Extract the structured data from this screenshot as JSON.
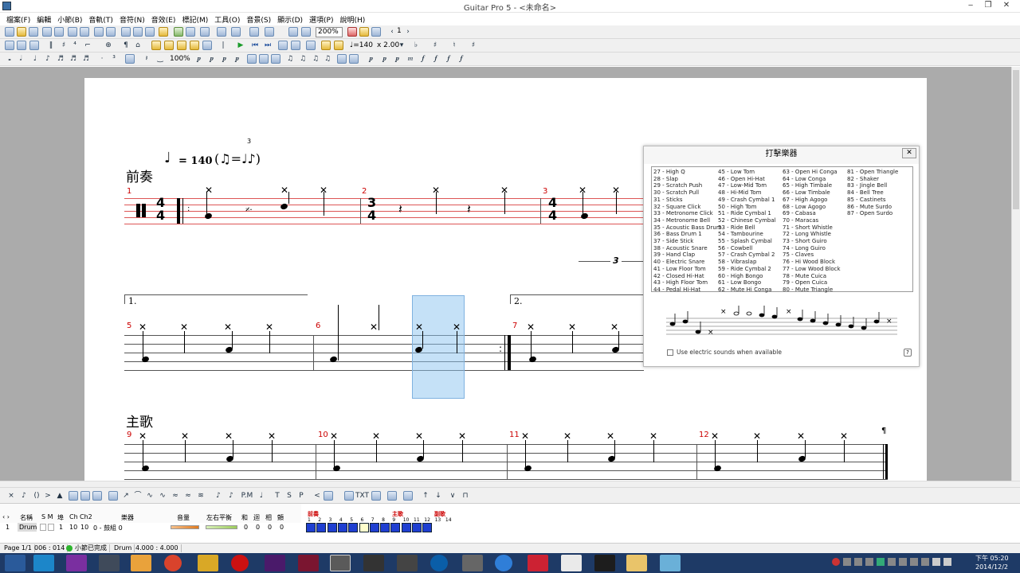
{
  "window": {
    "title": "Guitar Pro 5 - <未命名>",
    "controls": [
      "‒",
      "❐",
      "✕"
    ]
  },
  "menu": [
    "檔案(F)",
    "編輯",
    "小節(B)",
    "音軌(T)",
    "音符(N)",
    "音效(E)",
    "標記(M)",
    "工具(O)",
    "音景(S)",
    "顯示(D)",
    "選項(P)",
    "說明(H)"
  ],
  "toolbar": {
    "zoom": "200%",
    "page_num": "1",
    "tempo": "♩=140",
    "speed": "x 2.00",
    "pct": "100%"
  },
  "score": {
    "tempo_marking": "= 140",
    "section_intro": "前奏",
    "section_verse": "主歌",
    "measures": [
      "1",
      "2",
      "3",
      "5",
      "6",
      "7",
      "9",
      "10",
      "11",
      "12"
    ],
    "volta1": "1.",
    "volta2": "2.",
    "triplet": "3",
    "time_sig_1": [
      "4",
      "4"
    ],
    "time_sig_2": [
      "3",
      "4"
    ],
    "time_sig_3": [
      "4",
      "4"
    ]
  },
  "percussion_dialog": {
    "title": "打擊樂器",
    "close": "✕",
    "columns": [
      [
        "27 - High Q",
        "28 - Slap",
        "29 - Scratch Push",
        "30 - Scratch Pull",
        "31 - Sticks",
        "32 - Square Click",
        "33 - Metronome Click",
        "34 - Metronome Bell",
        "35 - Acoustic Bass Drum",
        "36 - Bass Drum 1",
        "37 - Side Stick",
        "38 - Acoustic Snare",
        "39 - Hand Clap",
        "40 - Electric Snare",
        "41 - Low Floor Tom",
        "42 - Closed Hi-Hat",
        "43 - High Floor Tom",
        "44 - Pedal Hi-Hat"
      ],
      [
        "45 - Low Tom",
        "46 - Open Hi-Hat",
        "47 - Low-Mid Tom",
        "48 - Hi-Mid Tom",
        "49 - Crash Cymbal 1",
        "50 - High Tom",
        "51 - Ride Cymbal 1",
        "52 - Chinese Cymbal",
        "53 - Ride Bell",
        "54 - Tambourine",
        "55 - Splash Cymbal",
        "56 - Cowbell",
        "57 - Crash Cymbal 2",
        "58 - Vibraslap",
        "59 - Ride Cymbal 2",
        "60 - High Bongo",
        "61 - Low Bongo",
        "62 - Mute Hi Conga"
      ],
      [
        "63 - Open Hi Conga",
        "64 - Low Conga",
        "65 - High Timbale",
        "66 - Low Timbale",
        "67 - High Agogo",
        "68 - Low Agogo",
        "69 - Cabasa",
        "70 - Maracas",
        "71 - Short Whistle",
        "72 - Long Whistle",
        "73 - Short Guiro",
        "74 - Long Guiro",
        "75 - Claves",
        "76 - Hi Wood Block",
        "77 - Low Wood Block",
        "78 - Mute Cuica",
        "79 - Open Cuica",
        "80 - Mute Triangle"
      ],
      [
        "81 - Open Triangle",
        "82 - Shaker",
        "83 - Jingle Bell",
        "84 - Bell Tree",
        "85 - Castinets",
        "86 - Mute Surdo",
        "87 - Open Surdo"
      ]
    ],
    "checkbox_label": "Use electric sounds when available",
    "help": "?"
  },
  "track_panel": {
    "headers": [
      "名稱",
      "S M",
      "埠",
      "Ch",
      "Ch2",
      "樂器",
      "音量",
      "左右平衡",
      "和",
      "迴",
      "相",
      "顫"
    ],
    "track": {
      "num": "1",
      "name": "Drum",
      "port": "1",
      "ch": "10",
      "ch2": "10",
      "instrument": "0 - 鼓組 0",
      "chorus": "0",
      "reverb": "0",
      "phaser": "0",
      "tremolo": "0"
    },
    "markers": [
      "前奏",
      "主歌",
      "副歌"
    ],
    "bar_numbers": [
      "1",
      "2",
      "3",
      "4",
      "5",
      "6",
      "7",
      "8",
      "9",
      "10",
      "11",
      "12",
      "13",
      "14"
    ]
  },
  "status": {
    "page": "Page 1/1",
    "position": "006 : 014",
    "message": "小節已完成",
    "track": "Drum",
    "time": "4.000 : 4.000"
  },
  "clock": {
    "time": "下午 05:20",
    "date": "2014/12/2"
  }
}
